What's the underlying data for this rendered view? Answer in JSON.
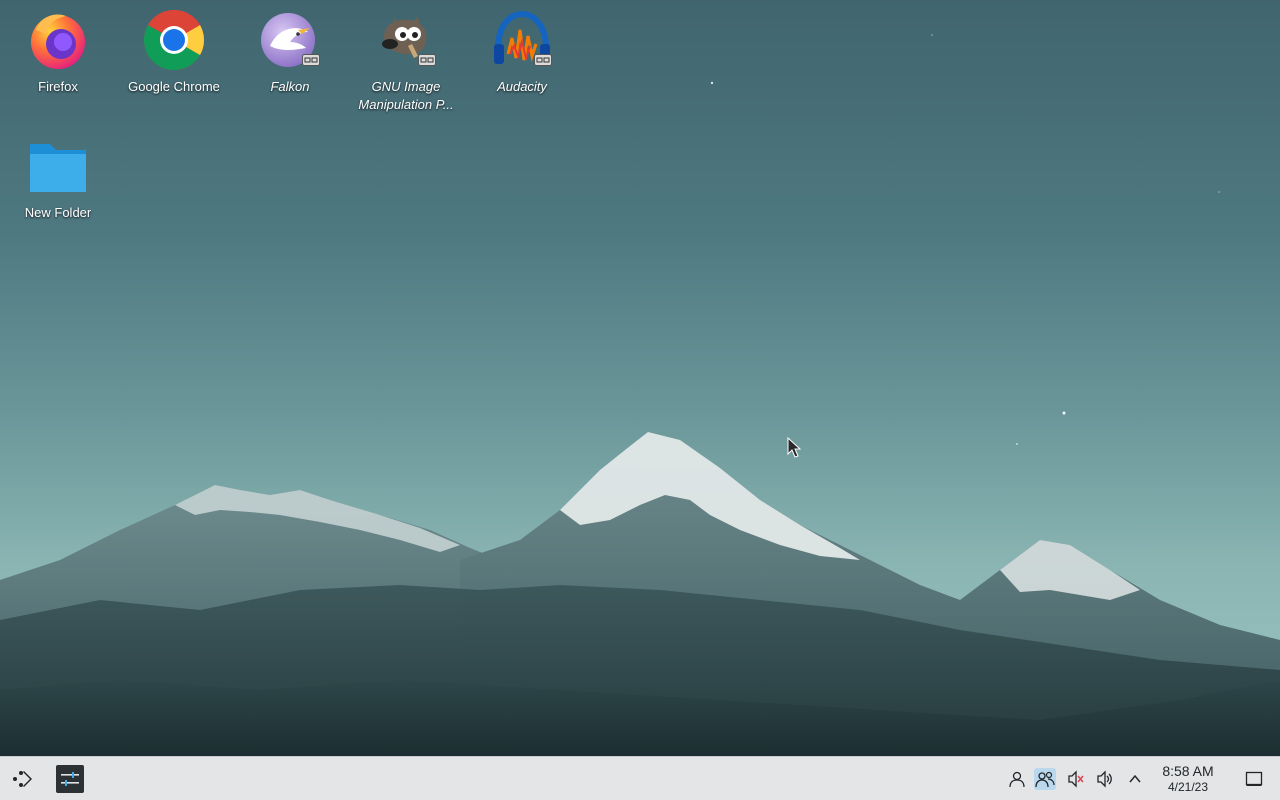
{
  "desktop": {
    "icons": [
      {
        "id": "firefox",
        "label": "Firefox",
        "icon": "firefox-icon",
        "italic": false
      },
      {
        "id": "google-chrome",
        "label": "Google Chrome",
        "icon": "chrome-icon",
        "italic": false
      },
      {
        "id": "falkon",
        "label": "Falkon",
        "icon": "falkon-icon",
        "italic": true
      },
      {
        "id": "gimp",
        "label": "GNU Image Manipulation P...",
        "icon": "gimp-icon",
        "italic": true
      },
      {
        "id": "audacity",
        "label": "Audacity",
        "icon": "audacity-icon",
        "italic": true
      },
      {
        "id": "new-folder",
        "label": "New Folder",
        "icon": "folder-icon",
        "italic": false
      }
    ]
  },
  "taskbar": {
    "launcher_icon": "application-launcher-icon",
    "task_icon": "system-settings-icon",
    "tray": [
      {
        "id": "user",
        "icon": "user-icon"
      },
      {
        "id": "network",
        "icon": "network-users-icon"
      },
      {
        "id": "mic-muted",
        "icon": "microphone-muted-icon"
      },
      {
        "id": "volume",
        "icon": "volume-icon"
      },
      {
        "id": "expand",
        "icon": "chevron-up-icon"
      }
    ],
    "clock": {
      "time": "8:58 AM",
      "date": "4/21/23"
    },
    "show_desktop_icon": "show-desktop-icon"
  },
  "colors": {
    "taskbar_bg": "#e3e5e7",
    "sky_top": "#40656f",
    "sky_bottom": "#9fc8c4",
    "mountain_dark": "#2e4a4e",
    "snow": "#e6ecec"
  }
}
